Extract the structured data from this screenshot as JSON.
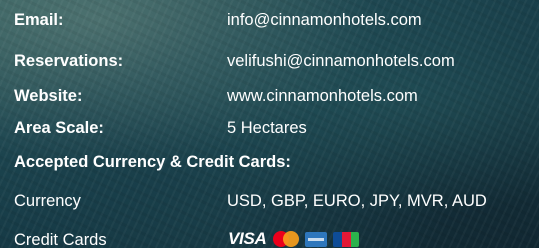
{
  "contact": {
    "email_label": "Email:",
    "email_value": "info@cinnamonhotels.com",
    "reservations_label": "Reservations:",
    "reservations_value": "velifushi@cinnamonhotels.com",
    "website_label": "Website:",
    "website_value": "www.cinnamonhotels.com",
    "area_label": "Area Scale:",
    "area_value": "5 Hectares"
  },
  "payment": {
    "heading": "Accepted Currency & Credit Cards:",
    "currency_label": "Currency",
    "currency_value": "USD, GBP, EURO, JPY, MVR, AUD",
    "cards_label": "Credit Cards",
    "cards": [
      {
        "name": "VISA",
        "icon": "visa-logo-icon"
      },
      {
        "name": "mastercard",
        "icon": "mastercard-logo-icon"
      },
      {
        "name": "amex",
        "icon": "amex-logo-icon"
      },
      {
        "name": "jcb",
        "icon": "jcb-logo-icon"
      }
    ]
  },
  "colors": {
    "text": "#ffffff",
    "background": "#1d4650"
  }
}
